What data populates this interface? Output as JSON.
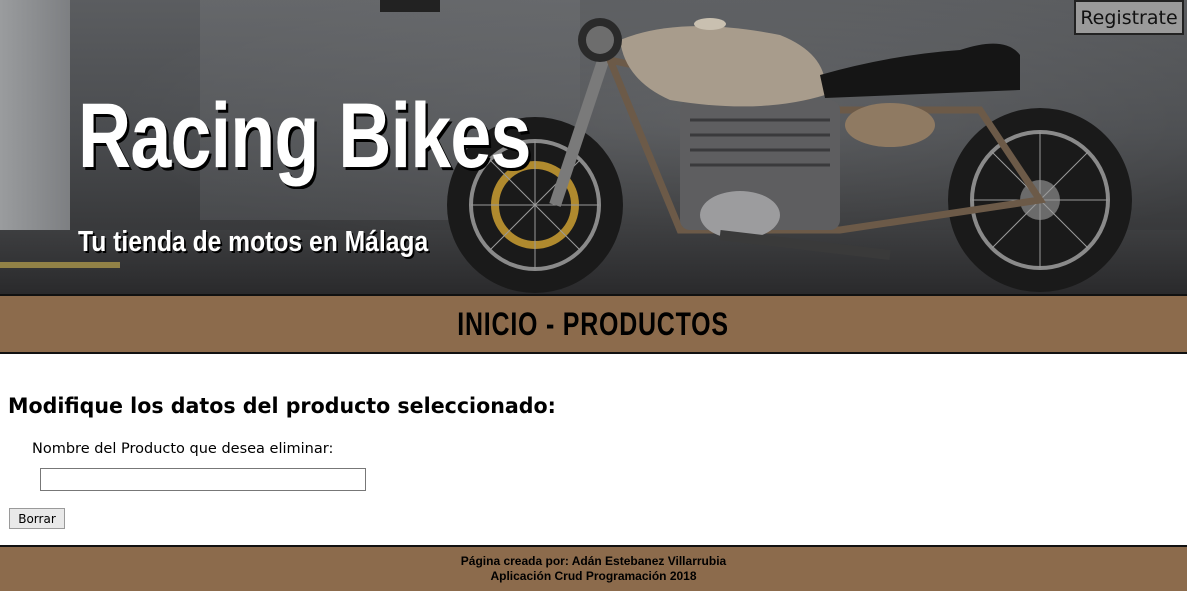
{
  "header": {
    "title": "Racing Bikes",
    "subtitle": "Tu tienda de motos en Málaga",
    "register_label": "Registrate",
    "image": "motorcycle-photo"
  },
  "nav": {
    "items": [
      "INICIO",
      "PRODUCTOS"
    ],
    "separator": " - "
  },
  "main": {
    "heading": "Modifique los datos del producto seleccionado:",
    "field_label": "Nombre del Producto que desea eliminar:",
    "field_value": "",
    "button_label": "Borrar"
  },
  "footer": {
    "line1": "Página creada por: Adán Estebanez Villarrubia",
    "line2": "Aplicación Crud Programación 2018"
  },
  "colors": {
    "brand_brown": "#8c6b4c",
    "register_bg": "#9a9a9a"
  }
}
